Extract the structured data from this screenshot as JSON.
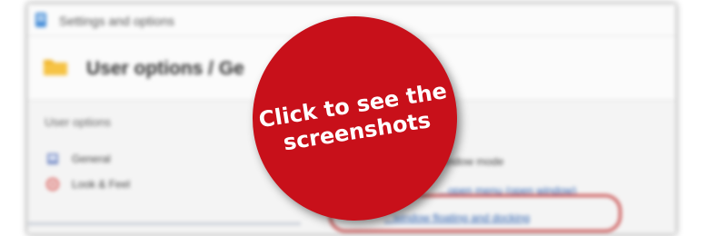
{
  "window": {
    "title": "Settings and options",
    "page_title": "User options / Ge",
    "section_label": "User options"
  },
  "sidebar": {
    "items": [
      {
        "label": "General"
      },
      {
        "label": "Look & Feel"
      }
    ]
  },
  "options": {
    "window_mode": "...window mode",
    "open_menu": "...open menu (open window)",
    "docking": "...window floating and docking"
  },
  "badge": {
    "line1": "Click to see the",
    "line2": "screenshots",
    "color": "#c8101a"
  }
}
